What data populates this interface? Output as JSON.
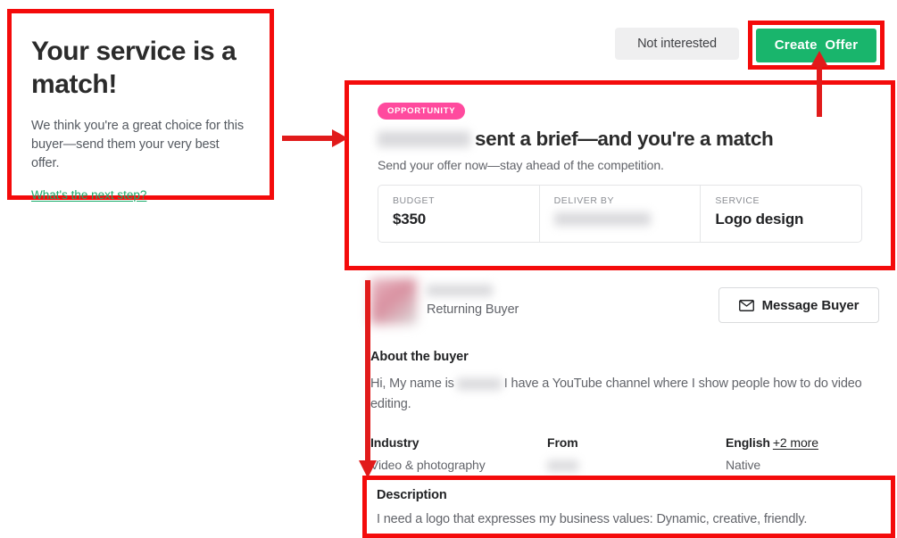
{
  "match_panel": {
    "title": "Your service is a match!",
    "subtitle": "We think you're a great choice for this buyer—send them your very best offer.",
    "link_label": "What's the next step?",
    "link_color": "#1aab6b"
  },
  "action_bar": {
    "not_interested_label": "Not interested",
    "create_offer_label": "Create  Offer",
    "create_offer_color": "#19b56c",
    "not_interested_bg": "#efeff0"
  },
  "opportunity": {
    "badge_label": "OPPORTUNITY",
    "badge_color": "#ff4a9e",
    "headline_name": "",
    "headline_rest": "sent a brief—and you're a match",
    "subtitle": "Send your offer now—stay ahead of the competition.",
    "stats": [
      {
        "label": "BUDGET",
        "value": "$350",
        "redacted": false
      },
      {
        "label": "DELIVER BY",
        "value": "",
        "redacted": true
      },
      {
        "label": "SERVICE",
        "value": "Logo design",
        "redacted": false
      }
    ]
  },
  "buyer": {
    "avatar_icon": "buyer-avatar-redacted",
    "name": "",
    "status": "Returning Buyer",
    "message_button_label": "Message Buyer",
    "message_button_icon": "envelope-icon",
    "about_heading": "About the buyer",
    "about_text_before": "Hi, My name is",
    "about_text_after": "I have a YouTube channel where I show people how to do video editing.",
    "meta": [
      {
        "label": "Industry",
        "value": "Video & photography",
        "redacted": false
      },
      {
        "label": "From",
        "value": "",
        "redacted": true
      },
      {
        "label": "English",
        "more_label": "+2 more",
        "value": "Native",
        "redacted": false
      }
    ]
  },
  "description": {
    "heading": "Description",
    "text": "I need a logo that expresses my business values: Dynamic, creative, friendly."
  },
  "annotations": {
    "highlight_color": "#f40b0b",
    "arrow_color": "#e11b1b",
    "boxes": [
      "match-panel-highlight",
      "create-offer-highlight",
      "opportunity-card-highlight",
      "description-highlight"
    ],
    "arrows": [
      "arrow-match-panel-to-opportunity-card",
      "arrow-opportunity-card-to-create-offer",
      "arrow-opportunity-card-to-description"
    ]
  }
}
